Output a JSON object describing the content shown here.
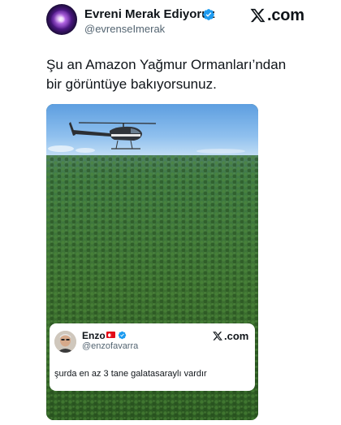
{
  "tweet": {
    "display_name": "Evreni Merak Ediyoruz",
    "handle": "@evrenseImerak",
    "brand_suffix": ".com",
    "text": "Şu an Amazon Yağmur Ormanları’ndan bir görüntüye bakıyorsunuz.",
    "verified_color": "#1d9bf0",
    "avatar_icon": "galaxy-avatar"
  },
  "quote": {
    "display_name": "Enzo",
    "flag_icon": "turkey-flag-icon",
    "handle": "@enzofavarra",
    "brand_suffix": ".com",
    "text": "şurda en az 3 tane galatasaraylı vardır"
  },
  "media": {
    "description_icon": "helicopter-over-forest-image"
  }
}
